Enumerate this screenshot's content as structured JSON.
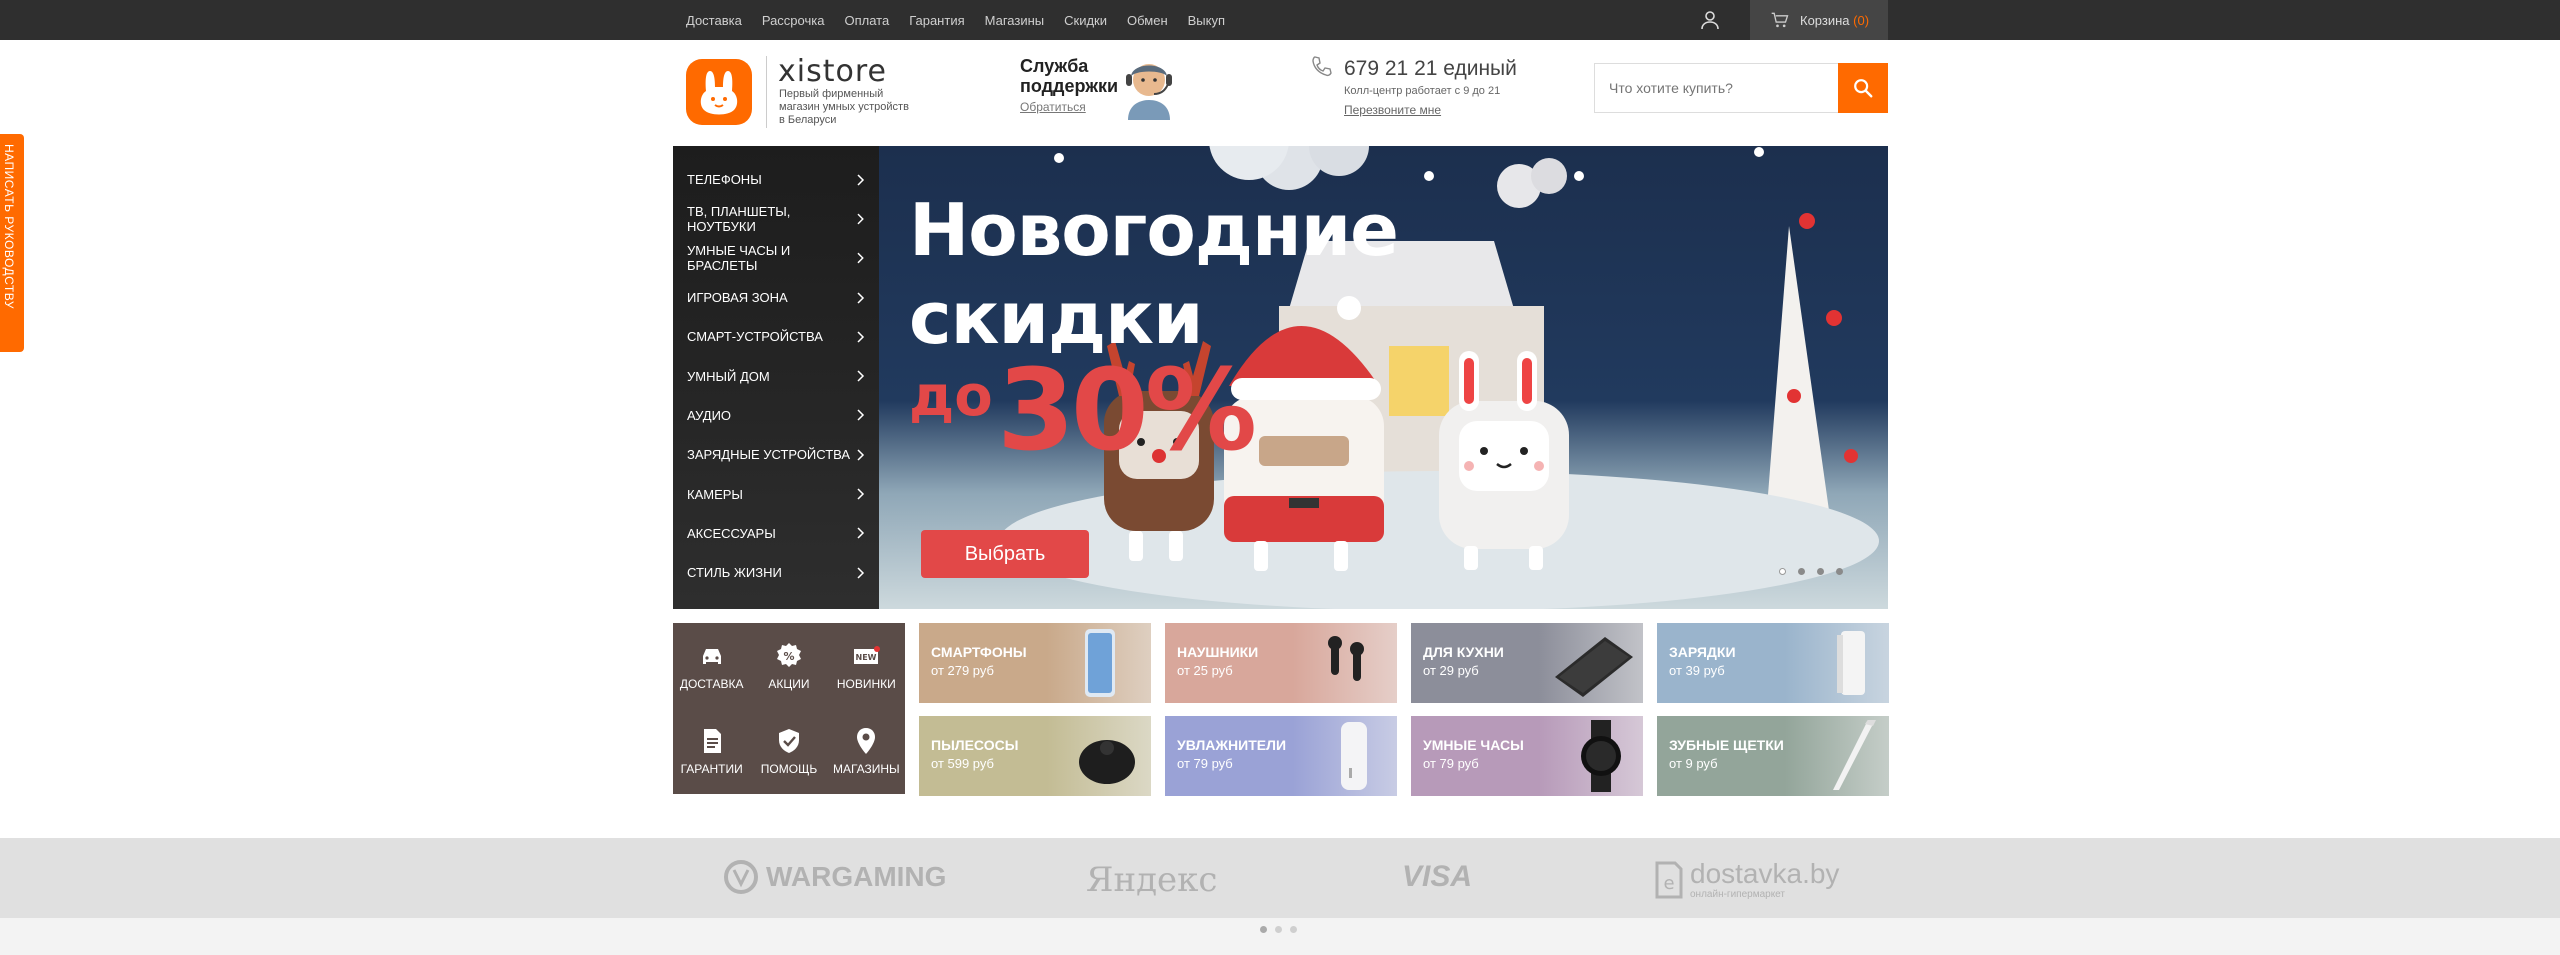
{
  "top_nav": {
    "links": [
      "Доставка",
      "Рассрочка",
      "Оплата",
      "Гарантия",
      "Магазины",
      "Скидки",
      "Обмен",
      "Выкуп"
    ],
    "cart_label": "Корзина",
    "cart_count": "(0)"
  },
  "header": {
    "logo_text": "xistore",
    "logo_sub": "Первый фирменный магазин умных устройств в Беларуси",
    "support_title": "Служба поддержки",
    "support_link": "Обратиться",
    "phone": "679 21 21 единый",
    "phone_hours": "Колл-центр работает с 9 до 21",
    "callback": "Перезвоните мне",
    "search_placeholder": "Что хотите купить?"
  },
  "side_tab": "НАПИСАТЬ РУКОВОДСТВУ",
  "categories": [
    "ТЕЛЕФОНЫ",
    "ТВ, ПЛАНШЕТЫ, НОУТБУКИ",
    "УМНЫЕ ЧАСЫ И БРАСЛЕТЫ",
    "ИГРОВАЯ ЗОНА",
    "СМАРТ-УСТРОЙСТВА",
    "УМНЫЙ ДОМ",
    "АУДИО",
    "ЗАРЯДНЫЕ УСТРОЙСТВА",
    "КАМЕРЫ",
    "АКСЕССУАРЫ",
    "СТИЛЬ ЖИЗНИ"
  ],
  "banner": {
    "title_line1": "Новогодние",
    "title_line2": "скидки",
    "prefix": "до",
    "discount": "30%",
    "button": "Выбрать",
    "slide_count": 4,
    "active_slide": 1
  },
  "quick_links": [
    "ДОСТАВКА",
    "АКЦИИ",
    "НОВИНКИ",
    "ГАРАНТИИ",
    "ПОМОЩЬ",
    "МАГАЗИНЫ"
  ],
  "quick_badge": "NEW",
  "tiles": [
    {
      "name": "СМАРТФОНЫ",
      "price": "от 279 руб",
      "color": "#c9a98a"
    },
    {
      "name": "НАУШНИКИ",
      "price": "от 25 руб",
      "color": "#d8a79b"
    },
    {
      "name": "ДЛЯ КУХНИ",
      "price": "от 29 руб",
      "color": "#8c8e9a"
    },
    {
      "name": "ЗАРЯДКИ",
      "price": "от 39 руб",
      "color": "#9ab4cc"
    },
    {
      "name": "ПЫЛЕСОСЫ",
      "price": "от 599 руб",
      "color": "#c3bc94"
    },
    {
      "name": "УВЛАЖНИТЕЛИ",
      "price": "от 79 руб",
      "color": "#9aa2d6"
    },
    {
      "name": "УМНЫЕ ЧАСЫ",
      "price": "от 79 руб",
      "color": "#b79ab9"
    },
    {
      "name": "ЗУБНЫЕ ЩЕТКИ",
      "price": "от 9 руб",
      "color": "#93a59a"
    }
  ],
  "partners": [
    "WARGAMING",
    "Яндекс",
    "VISA",
    "dostavka.by",
    "онлайн-гипермаркет"
  ]
}
